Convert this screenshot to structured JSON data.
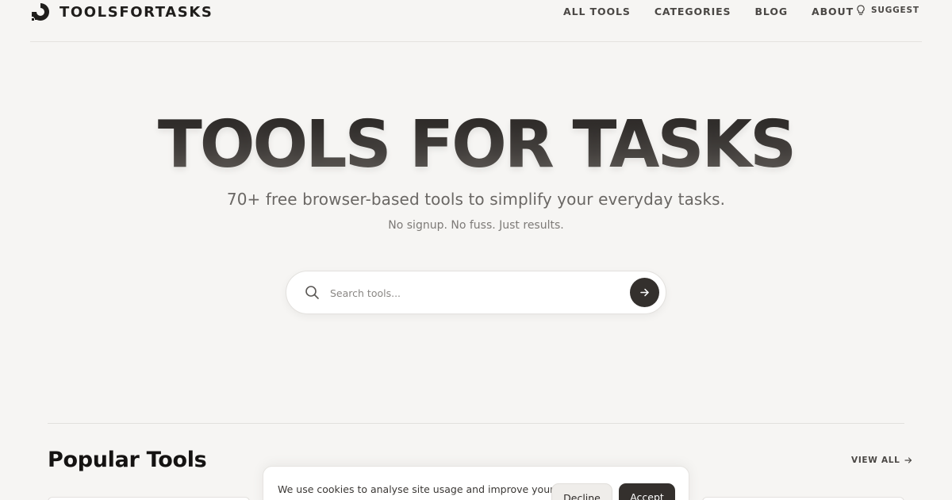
{
  "header": {
    "logo_text": "TOOLSFORTASKS",
    "nav": [
      "ALL TOOLS",
      "CATEGORIES",
      "BLOG",
      "ABOUT"
    ],
    "suggest_label": "SUGGEST"
  },
  "hero": {
    "title": "TOOLS FOR TASKS",
    "subtitle": "70+ free browser-based tools to simplify your everyday tasks.",
    "tagline": "No signup. No fuss. Just results."
  },
  "search": {
    "placeholder": "Search tools..."
  },
  "popular": {
    "title": "Popular Tools",
    "view_all_label": "VIEW ALL"
  },
  "cookie": {
    "text": "We use cookies to analyse site usage and improve your",
    "decline_label": "Decline",
    "accept_label": "Accept"
  },
  "colors": {
    "background": "#f6f5f3",
    "accent_dark": "#34302d",
    "text_primary": "#1f1d1b"
  },
  "icons": [
    "logo-mark-icon",
    "lightbulb-icon",
    "search-icon",
    "arrow-right-icon"
  ]
}
